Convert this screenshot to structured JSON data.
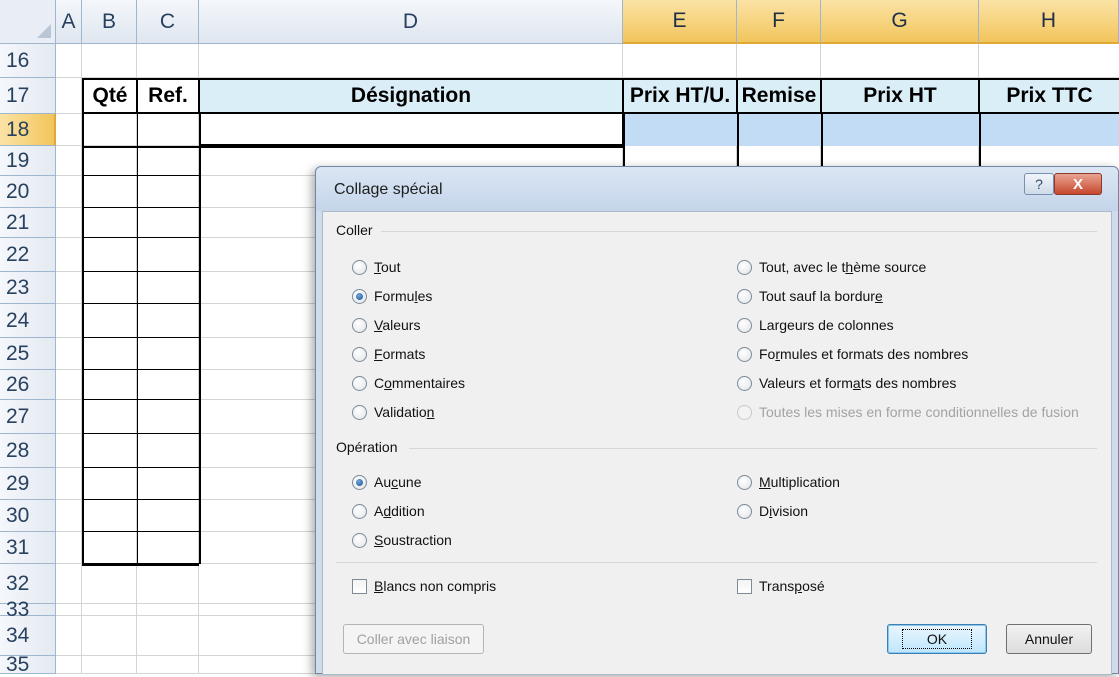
{
  "sheet": {
    "columns": [
      "A",
      "B",
      "C",
      "D",
      "E",
      "F",
      "G",
      "H"
    ],
    "rows": [
      "16",
      "17",
      "18",
      "19",
      "20",
      "21",
      "22",
      "23",
      "24",
      "25",
      "26",
      "27",
      "28",
      "29",
      "30",
      "31",
      "32",
      "33",
      "34",
      "35"
    ],
    "header_row": {
      "qte": "Qté",
      "ref": "Ref.",
      "designation": "Désignation",
      "prix_ht_u": "Prix HT/U.",
      "remise": "Remise",
      "prix_ht": "Prix HT",
      "prix_ttc": "Prix TTC"
    }
  },
  "dialog": {
    "title": "Collage spécial",
    "help": "?",
    "close": "X",
    "coller_group": "Coller",
    "paste_left": [
      {
        "pre": "",
        "u": "T",
        "post": "out",
        "selected": false
      },
      {
        "pre": "Formu",
        "u": "l",
        "post": "es",
        "selected": true
      },
      {
        "pre": "",
        "u": "V",
        "post": "aleurs",
        "selected": false
      },
      {
        "pre": "",
        "u": "F",
        "post": "ormats",
        "selected": false
      },
      {
        "pre": "C",
        "u": "o",
        "post": "mmentaires",
        "selected": false
      },
      {
        "pre": "Validatio",
        "u": "n",
        "post": "",
        "selected": false
      }
    ],
    "paste_right": [
      {
        "pre": "Tout, avec le t",
        "u": "h",
        "post": "ème source",
        "selected": false,
        "disabled": false
      },
      {
        "pre": "Tout sauf la bordur",
        "u": "e",
        "post": "",
        "selected": false,
        "disabled": false
      },
      {
        "pre": "Lar",
        "u": "g",
        "post": "eurs de colonnes",
        "selected": false,
        "disabled": false
      },
      {
        "pre": "Fo",
        "u": "r",
        "post": "mules et formats des nombres",
        "selected": false,
        "disabled": false
      },
      {
        "pre": "Valeurs et form",
        "u": "a",
        "post": "ts des nombres",
        "selected": false,
        "disabled": false
      },
      {
        "pre": "Toutes les mises en forme conditionnelles de fusion",
        "u": "",
        "post": "",
        "selected": false,
        "disabled": true
      }
    ],
    "operation_group": "Opération",
    "op_left": [
      {
        "pre": "Au",
        "u": "c",
        "post": "une",
        "selected": true
      },
      {
        "pre": "A",
        "u": "d",
        "post": "dition",
        "selected": false
      },
      {
        "pre": "",
        "u": "S",
        "post": "oustraction",
        "selected": false
      }
    ],
    "op_right": [
      {
        "pre": "",
        "u": "M",
        "post": "ultiplication",
        "selected": false
      },
      {
        "pre": "D",
        "u": "i",
        "post": "vision",
        "selected": false
      }
    ],
    "blancs": {
      "pre": "",
      "u": "B",
      "post": "lancs non compris"
    },
    "transpose": {
      "pre": "Trans",
      "u": "p",
      "post": "osé"
    },
    "paste_link": "Coller avec liaison",
    "ok": "OK",
    "cancel": "Annuler"
  }
}
